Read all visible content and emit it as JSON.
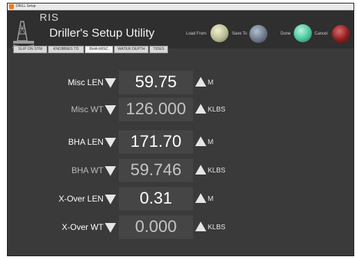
{
  "window_title": "DRILL Setup",
  "app": {
    "logo_text": "RIS",
    "title": "Driller's Setup Utility"
  },
  "header_buttons": {
    "load_from": "Load From",
    "save_to": "Save To",
    "done": "Done",
    "cancel": "Cancel"
  },
  "tabs": [
    "SLIP ON STM",
    "KNOBBIES TD",
    "BHA-MISC",
    "WATER DEPTH",
    "TIDES"
  ],
  "active_tab": "BHA-MISC",
  "rows": [
    {
      "label": "Misc LEN",
      "value": "59.75",
      "unit": "M"
    },
    {
      "label": "Misc WT",
      "value": "126.000",
      "unit": "KLBS"
    },
    {
      "label": "BHA LEN",
      "value": "171.70",
      "unit": "M"
    },
    {
      "label": "BHA WT",
      "value": "59.746",
      "unit": "KLBS"
    },
    {
      "label": "X-Over LEN",
      "value": "0.31",
      "unit": "M"
    },
    {
      "label": "X-Over WT",
      "value": "0.000",
      "unit": "KLBS"
    }
  ],
  "colors": {
    "panel_bg": "#3a3a3a",
    "value_box_bg": "#454545",
    "load_from_orb": "#b9b992",
    "save_to_orb": "#6d7889",
    "done_orb": "#49c49a",
    "cancel_orb": "#8b1d1d"
  }
}
